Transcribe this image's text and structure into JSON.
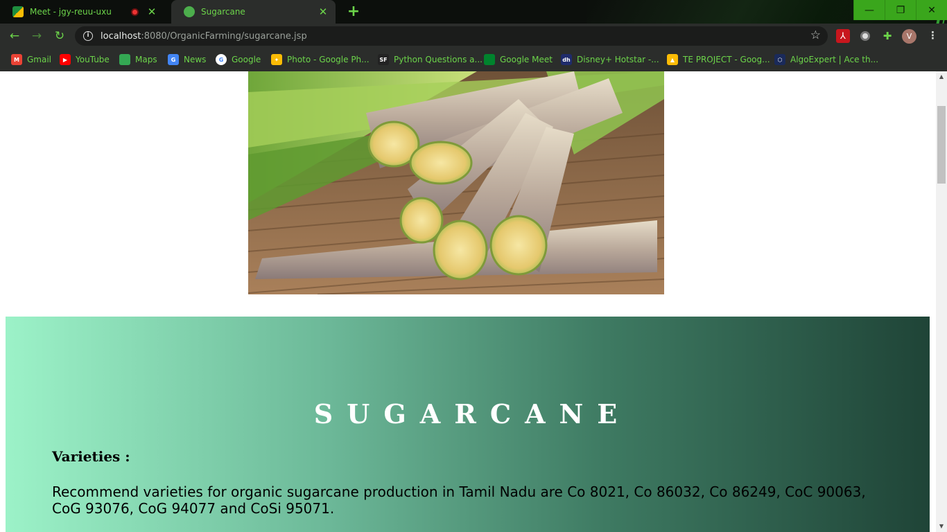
{
  "browser": {
    "tabs": [
      {
        "title": "Meet - jgy-reuu-uxu",
        "recording": true,
        "favicon_color": "#1e8e3e"
      },
      {
        "title": "Sugarcane",
        "favicon_color": "#4cae4c"
      }
    ],
    "new_tab_glyph": "+",
    "window_buttons": {
      "minimize": "—",
      "restore": "❐",
      "close": "✕"
    },
    "url_host": "localhost",
    "url_rest": ":8080/OrganicFarming/sugarcane.jsp",
    "profile_initial": "V",
    "bookmarks": [
      {
        "label": "Gmail",
        "icon": "gmail-icon",
        "color": "#ea4335",
        "glyph": "M"
      },
      {
        "label": "YouTube",
        "icon": "youtube-icon",
        "color": "#ff0000",
        "glyph": "▶"
      },
      {
        "label": "Maps",
        "icon": "maps-icon",
        "color": "#34a853",
        "glyph": ""
      },
      {
        "label": "News",
        "icon": "news-icon",
        "color": "#4285f4",
        "glyph": "G"
      },
      {
        "label": "Google",
        "icon": "google-icon",
        "color": "#ffffff",
        "glyph": "G"
      },
      {
        "label": "Photo - Google Ph...",
        "icon": "google-photos-icon",
        "color": "#fbbc05",
        "glyph": "✦"
      },
      {
        "label": "Python Questions a...",
        "icon": "sanfoundry-icon",
        "color": "#222222",
        "glyph": "SF"
      },
      {
        "label": "Google Meet",
        "icon": "google-meet-icon",
        "color": "#00832d",
        "glyph": ""
      },
      {
        "label": "Disney+ Hotstar -...",
        "icon": "hotstar-icon",
        "color": "#1f2b6b",
        "glyph": "dh"
      },
      {
        "label": "TE PROJECT - Goog...",
        "icon": "google-drive-icon",
        "color": "#fbbc05",
        "glyph": "▲"
      },
      {
        "label": "AlgoExpert | Ace th...",
        "icon": "algoexpert-icon",
        "color": "#1a2a5a",
        "glyph": "⬡"
      }
    ]
  },
  "page": {
    "title": "SUGARCANE",
    "varieties_heading": "Varieties :",
    "varieties_text": "Recommend varieties for organic sugarcane production in Tamil Nadu are Co 8021, Co 86032, Co 86249, CoC 90063, CoG 93076, CoG 94077 and CoSi 95071.",
    "panel_gradient": [
      "#9cf2c8",
      "#1f4437"
    ]
  }
}
